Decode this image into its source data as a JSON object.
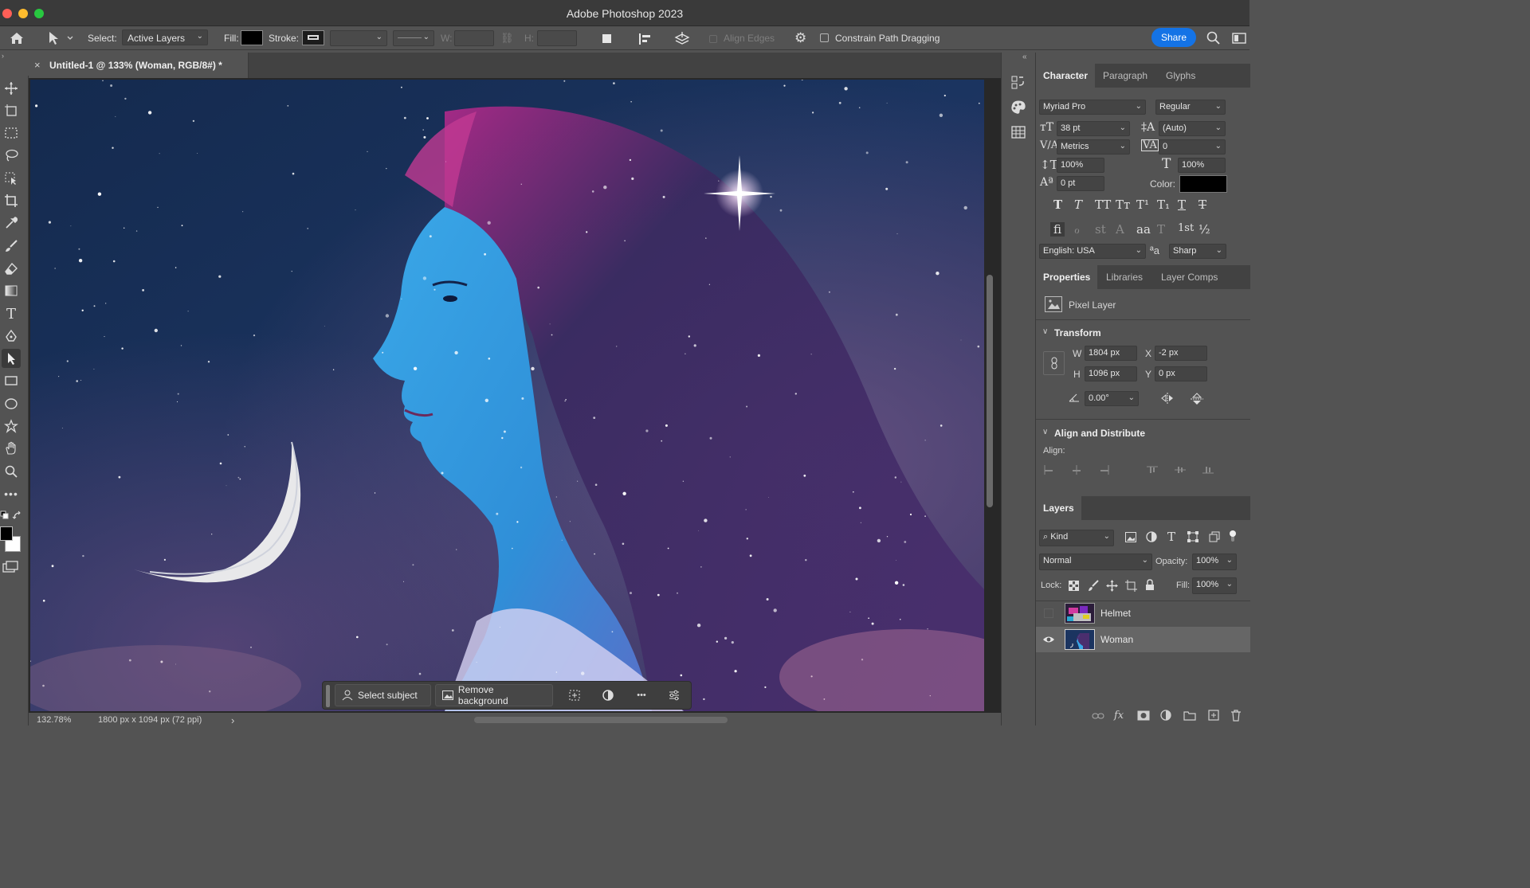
{
  "window": {
    "title": "Adobe Photoshop 2023"
  },
  "options_bar": {
    "select_label": "Select:",
    "select_value": "Active Layers",
    "fill_label": "Fill:",
    "stroke_label": "Stroke:",
    "w_label": "W:",
    "h_label": "H:",
    "align_edges_label": "Align Edges",
    "constrain_label": "Constrain Path Dragging",
    "share_label": "Share"
  },
  "document": {
    "tab_title": "Untitled-1 @ 133% (Woman, RGB/8#) *",
    "close_glyph": "×"
  },
  "status": {
    "zoom": "132.78%",
    "doc_info": "1800 px x 1094 px (72 ppi)",
    "arrow": "›"
  },
  "context_bar": {
    "select_subject": "Select subject",
    "remove_background": "Remove background",
    "more": "•••"
  },
  "character": {
    "tabs": [
      "Character",
      "Paragraph",
      "Glyphs"
    ],
    "font_family": "Myriad Pro",
    "font_style": "Regular",
    "font_size": "38 pt",
    "leading": "(Auto)",
    "kerning": "Metrics",
    "tracking": "0",
    "vertical_scale": "100%",
    "horizontal_scale": "100%",
    "baseline_shift": "0 pt",
    "color_label": "Color:",
    "language": "English: USA",
    "antialias_glyph": "ªa",
    "antialias": "Sharp",
    "style_glyphs_row1": [
      "T",
      "T",
      "TT",
      "Tт",
      "T¹",
      "T₁",
      "T",
      "T"
    ],
    "style_glyphs_row2": [
      "fi",
      "ℴ",
      "st",
      "A",
      "aa",
      "T",
      "1st",
      "½"
    ]
  },
  "properties": {
    "tabs": [
      "Properties",
      "Libraries",
      "Layer Comps"
    ],
    "layer_type": "Pixel Layer",
    "transform_label": "Transform",
    "w_label": "W",
    "w_value": "1804 px",
    "x_label": "X",
    "x_value": "-2 px",
    "h_label": "H",
    "h_value": "1096 px",
    "y_label": "Y",
    "y_value": "0 px",
    "angle_value": "0.00°",
    "align_distribute_label": "Align and Distribute",
    "align_label": "Align:"
  },
  "layers": {
    "tab": "Layers",
    "kind_label": "Kind",
    "blend_mode": "Normal",
    "opacity_label": "Opacity:",
    "opacity_value": "100%",
    "lock_label": "Lock:",
    "fill_label": "Fill:",
    "fill_value": "100%",
    "items": [
      {
        "name": "Helmet",
        "visible": false
      },
      {
        "name": "Woman",
        "visible": true,
        "selected": true
      }
    ],
    "footer_fx": "fx"
  },
  "colors": {
    "accent": "#1473e6",
    "panel_bg": "#535353",
    "foreground_swatch": "#000000",
    "background_swatch": "#ffffff"
  }
}
